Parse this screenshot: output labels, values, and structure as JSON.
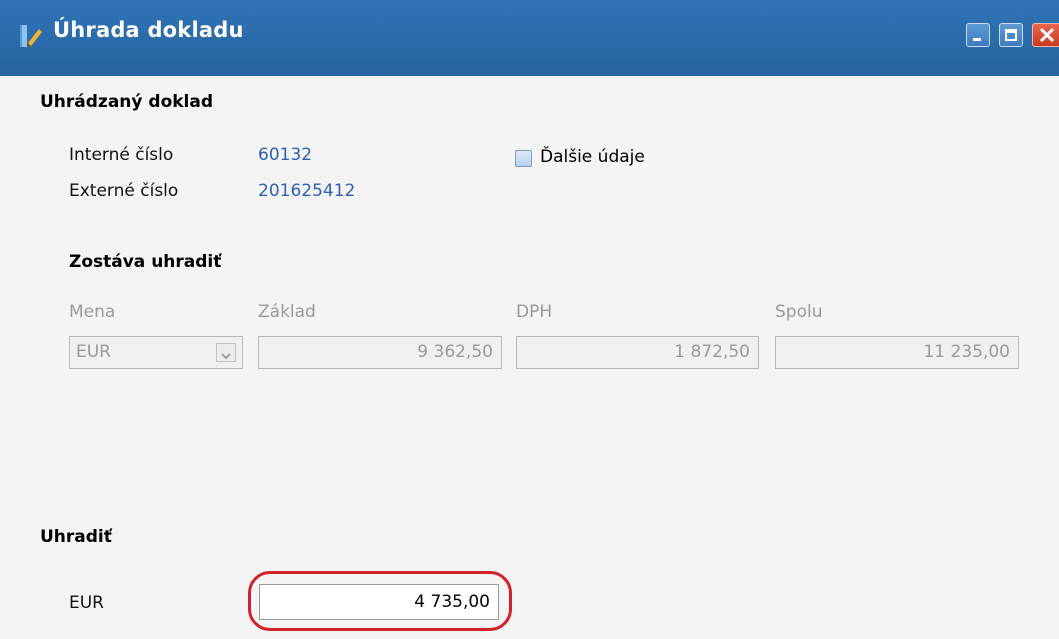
{
  "window": {
    "title": "Úhrada dokladu",
    "icon": "pencil-document-icon",
    "controls": [
      "minimize-icon",
      "maximize-icon",
      "close-icon"
    ]
  },
  "document_section": {
    "heading": "Uhrádzaný doklad",
    "internal_label": "Interné číslo",
    "internal_value": "60132",
    "external_label": "Externé číslo",
    "external_value": "201625412",
    "more_details_label": "Ďalšie údaje",
    "more_details_checked": false
  },
  "remaining_section": {
    "heading": "Zostáva uhradiť",
    "currency_label": "Mena",
    "currency_value": "EUR",
    "base_label": "Základ",
    "base_value": "9 362,50",
    "vat_label": "DPH",
    "vat_value": "1 872,50",
    "total_label": "Spolu",
    "total_value": "11 235,00"
  },
  "pay_section": {
    "heading": "Uhradiť",
    "currency_label": "EUR",
    "amount_value": "4 735,00"
  },
  "colors": {
    "titlebar": "#2a6aa8",
    "link_value": "#2f5fb3",
    "highlight": "#d4202a"
  }
}
